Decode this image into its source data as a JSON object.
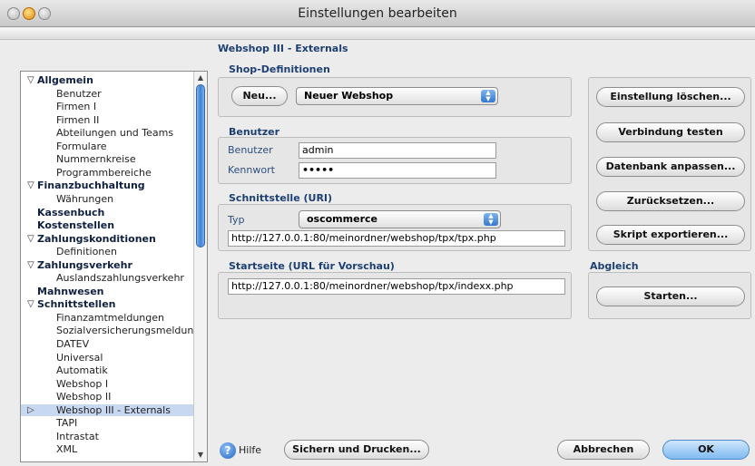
{
  "window": {
    "title": "Einstellungen bearbeiten"
  },
  "section": {
    "title": "Webshop III - Externals"
  },
  "tree": [
    {
      "label": "Allgemein",
      "level": "top",
      "disclosure": "open"
    },
    {
      "label": "Benutzer",
      "level": "child"
    },
    {
      "label": "Firmen I",
      "level": "child"
    },
    {
      "label": "Firmen II",
      "level": "child"
    },
    {
      "label": "Abteilungen und Teams",
      "level": "child"
    },
    {
      "label": "Formulare",
      "level": "child"
    },
    {
      "label": "Nummernkreise",
      "level": "child"
    },
    {
      "label": "Programmbereiche",
      "level": "child"
    },
    {
      "label": "Finanzbuchhaltung",
      "level": "top",
      "disclosure": "open"
    },
    {
      "label": "Währungen",
      "level": "child"
    },
    {
      "label": "Kassenbuch",
      "level": "top"
    },
    {
      "label": "Kostenstellen",
      "level": "top"
    },
    {
      "label": "Zahlungskonditionen",
      "level": "top",
      "disclosure": "open"
    },
    {
      "label": "Definitionen",
      "level": "child"
    },
    {
      "label": "Zahlungsverkehr",
      "level": "top",
      "disclosure": "open"
    },
    {
      "label": "Auslandszahlungsverkehr",
      "level": "child"
    },
    {
      "label": "Mahnwesen",
      "level": "top"
    },
    {
      "label": "Schnittstellen",
      "level": "top",
      "disclosure": "open"
    },
    {
      "label": "Finanzamtmeldungen",
      "level": "child"
    },
    {
      "label": "Sozialversicherungsmeldun...",
      "level": "child"
    },
    {
      "label": "DATEV",
      "level": "child"
    },
    {
      "label": "Universal",
      "level": "child"
    },
    {
      "label": "Automatik",
      "level": "child"
    },
    {
      "label": "Webshop I",
      "level": "child"
    },
    {
      "label": "Webshop II",
      "level": "child"
    },
    {
      "label": "Webshop III - Externals",
      "level": "child",
      "selected": true,
      "marker": "▷"
    },
    {
      "label": "TAPI",
      "level": "child"
    },
    {
      "label": "Intrastat",
      "level": "child"
    },
    {
      "label": "XML",
      "level": "child"
    }
  ],
  "shop": {
    "title": "Shop-Definitionen",
    "new_button": "Neu...",
    "selected_shop": "Neuer Webshop"
  },
  "user": {
    "title": "Benutzer",
    "user_label": "Benutzer",
    "user_value": "admin",
    "password_label": "Kennwort",
    "password_value": "•••••"
  },
  "interface": {
    "title": "Schnittstelle (URI)",
    "type_label": "Typ",
    "type_value": "oscommerce",
    "uri_value": "http://127.0.0.1:80/meinordner/webshop/tpx/tpx.php"
  },
  "startpage": {
    "title": "Startseite (URL für Vorschau)",
    "url_value": "http://127.0.0.1:80/meinordner/webshop/tpx/indexx.php"
  },
  "actions": {
    "delete": "Einstellung löschen...",
    "test": "Verbindung testen",
    "adjust_db": "Datenbank anpassen...",
    "reset": "Zurücksetzen...",
    "export_script": "Skript exportieren..."
  },
  "sync": {
    "title": "Abgleich",
    "start": "Starten..."
  },
  "footer": {
    "help_icon_glyph": "?",
    "help": "Hilfe",
    "save_print": "Sichern und Drucken...",
    "cancel": "Abbrechen",
    "ok": "OK"
  },
  "icons": {
    "disclosure_open": "▽",
    "scroll_up": "▲",
    "scroll_down": "▼",
    "popup_arrows": "▲▼"
  }
}
